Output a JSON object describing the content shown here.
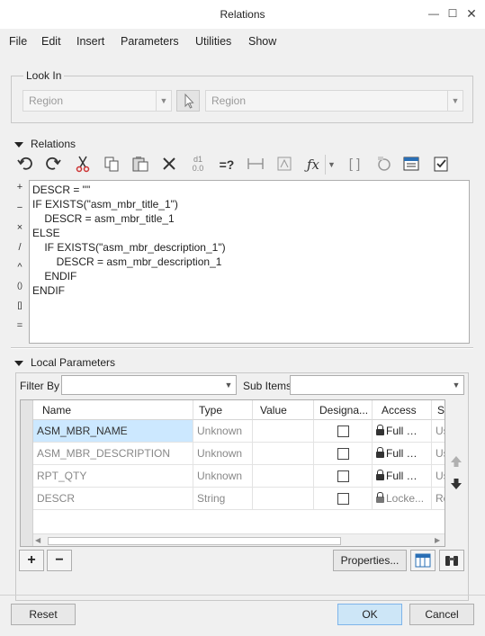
{
  "window": {
    "title": "Relations",
    "minimize_icon": "minimize-icon",
    "maximize_icon": "maximize-icon",
    "close_icon": "close-icon"
  },
  "menu": [
    "File",
    "Edit",
    "Insert",
    "Parameters",
    "Utilities",
    "Show"
  ],
  "look_in": {
    "label": "Look In",
    "type_value": "Region",
    "item_value": "Region"
  },
  "relations": {
    "label": "Relations",
    "side_tools": [
      "+",
      "−",
      "×",
      "/",
      "^",
      "()",
      "[]",
      "="
    ],
    "code": [
      "DESCR = \"\"",
      "IF EXISTS(\"asm_mbr_title_1\")",
      "    DESCR = asm_mbr_title_1",
      "ELSE",
      "    IF EXISTS(\"asm_mbr_description_1\")",
      "        DESCR = asm_mbr_description_1",
      "    ENDIF",
      "ENDIF"
    ]
  },
  "local_params": {
    "label": "Local Parameters",
    "filter_by_label": "Filter By",
    "sub_items_label": "Sub Items",
    "columns": [
      "Name",
      "Type",
      "Value",
      "Designa...",
      "Access",
      "S"
    ],
    "rows": [
      {
        "name": "ASM_MBR_NAME",
        "type": "Unknown",
        "value": "",
        "access": "Full",
        "s": "Us"
      },
      {
        "name": "ASM_MBR_DESCRIPTION",
        "type": "Unknown",
        "value": "",
        "access": "Full",
        "s": "Us"
      },
      {
        "name": "RPT_QTY",
        "type": "Unknown",
        "value": "",
        "access": "Full",
        "s": "Us"
      },
      {
        "name": "DESCR",
        "type": "String",
        "value": "",
        "access": "Locke...",
        "s": "Re"
      }
    ],
    "properties_label": "Properties..."
  },
  "footer": {
    "reset": "Reset",
    "ok": "OK",
    "cancel": "Cancel"
  }
}
